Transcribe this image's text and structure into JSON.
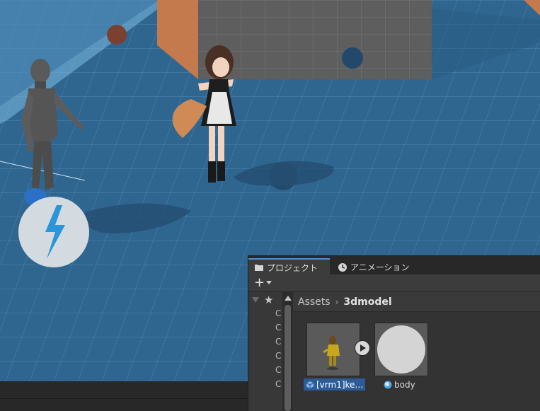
{
  "scene": {
    "scale_hint_icon": "lightning-icon"
  },
  "project_window": {
    "tabs": [
      {
        "label": "プロジェクト",
        "icon": "folder-icon",
        "active": true
      },
      {
        "label": "アニメーション",
        "icon": "clock-icon",
        "active": false
      }
    ],
    "toolbar": {
      "add_label": "+"
    },
    "tree_rows": [
      "C",
      "C",
      "C",
      "C",
      "C",
      "C"
    ],
    "breadcrumb": {
      "root": "Assets",
      "separator": "›",
      "folder": "3dmodel"
    },
    "assets": [
      {
        "label": "[vrm1]ke…",
        "icon": "prefab-icon",
        "selected": true
      },
      {
        "label": "body",
        "icon": "material-icon",
        "selected": false
      }
    ]
  },
  "colors": {
    "floor": "#2f6690",
    "grid_line": "#6da3cf",
    "wall": "#c47a4d",
    "panel_bg": "#383838",
    "selection": "#2d5b96"
  }
}
